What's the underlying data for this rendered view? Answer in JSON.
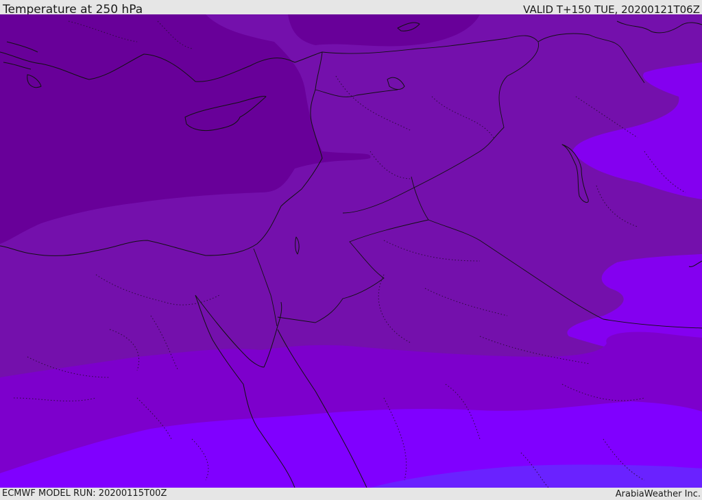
{
  "header": {
    "title": "Temperature at 250 hPa",
    "valid": "VALID T+150 TUE, 20200121T06Z"
  },
  "footer": {
    "model_run": "ECMWF MODEL RUN: 20200115T00Z",
    "credit": "ArabiaWeather Inc."
  },
  "map": {
    "colors": {
      "coldest": "#680099",
      "cold": "#7410ac",
      "mid": "#7d00cc",
      "warm": "#8400f0",
      "warmer": "#8000ff",
      "warmest": "#6a22ff"
    }
  }
}
